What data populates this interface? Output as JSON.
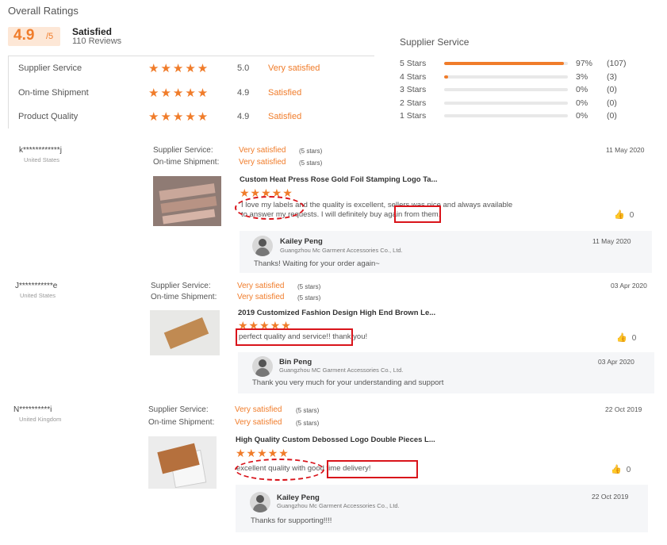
{
  "overall": {
    "title": "Overall Ratings",
    "score": "4.9",
    "out_of": "/5",
    "label": "Satisfied",
    "reviews": "110 Reviews"
  },
  "ratings": [
    {
      "name": "Supplier Service",
      "stars": "★★★★★",
      "value": "5.0",
      "text": "Very satisfied"
    },
    {
      "name": "On-time Shipment",
      "stars": "★★★★★",
      "value": "4.9",
      "text": "Satisfied"
    },
    {
      "name": "Product Quality",
      "stars": "★★★★★",
      "value": "4.9",
      "text": "Satisfied"
    }
  ],
  "supplier_service": {
    "title": "Supplier Service",
    "rows": [
      {
        "label": "5  Stars",
        "fraction": 0.97,
        "pct": "97%",
        "count": "(107)"
      },
      {
        "label": "4  Stars",
        "fraction": 0.03,
        "pct": "3%",
        "count": "(3)"
      },
      {
        "label": "3  Stars",
        "fraction": 0,
        "pct": "0%",
        "count": "(0)"
      },
      {
        "label": "2  Stars",
        "fraction": 0,
        "pct": "0%",
        "count": "(0)"
      },
      {
        "label": "1  Stars",
        "fraction": 0,
        "pct": "0%",
        "count": "(0)"
      }
    ]
  },
  "reviews": [
    {
      "reviewer": "k************j",
      "country": "United States",
      "supplier_label": "Supplier Service:",
      "supplier_value": "Very satisfied",
      "supplier_stars": "(5 stars)",
      "shipment_label": "On-time Shipment:",
      "shipment_value": "Very satisfied",
      "shipment_stars": "(5 stars)",
      "date": "11 May 2020",
      "product": "Custom Heat Press Rose Gold Foil Stamping Logo Ta...",
      "stars": "★★★★★",
      "comment_line1": "I love my labels and the quality is excellent, sellers was nice and always available",
      "comment_line2": "to answer my requests. I will definitely buy again from them.",
      "likes": "0",
      "reply_name": "Kailey Peng",
      "reply_company": "Guangzhou Mc Garment Accessories Co., Ltd.",
      "reply_date": "11 May 2020",
      "reply_text": "Thanks! Waiting for your order again~"
    },
    {
      "reviewer": "J***********e",
      "country": "United States",
      "supplier_label": "Supplier Service:",
      "supplier_value": "Very satisfied",
      "supplier_stars": "(5 stars)",
      "shipment_label": "On-time Shipment:",
      "shipment_value": "Very satisfied",
      "shipment_stars": "(5 stars)",
      "date": "03 Apr 2020",
      "product": "2019 Customized Fashion Design High End Brown Le...",
      "stars": "★★★★★",
      "comment_line1": "perfect quality and service!! thank you!",
      "likes": "0",
      "reply_name": "Bin Peng",
      "reply_company": "Guangzhou MC Garment Accessories Co., Ltd.",
      "reply_date": "03 Apr 2020",
      "reply_text": "Thank you very much for your understanding and support"
    },
    {
      "reviewer": "N**********i",
      "country": "United Kingdom",
      "supplier_label": "Supplier Service:",
      "supplier_value": "Very satisfied",
      "supplier_stars": "(5 stars)",
      "shipment_label": "On-time Shipment:",
      "shipment_value": "Very satisfied",
      "shipment_stars": "(5 stars)",
      "date": "22 Oct 2019",
      "product": "High Quality Custom Debossed Logo Double Pieces L...",
      "stars": "★★★★★",
      "comment_line1": "excellent quality with good time delivery!",
      "likes": "0",
      "reply_name": "Kailey Peng",
      "reply_company": "Guangzhou Mc Garment Accessories Co., Ltd.",
      "reply_date": "22 Oct 2019",
      "reply_text": "Thanks for supporting!!!!"
    }
  ],
  "colors": {
    "accent": "#f07c2a",
    "annotation": "#d9141b",
    "reply_bg": "#f5f6f8"
  }
}
